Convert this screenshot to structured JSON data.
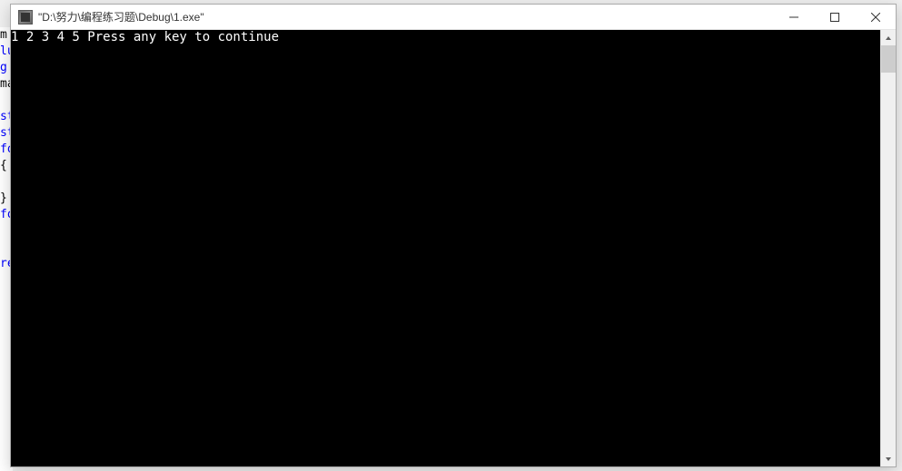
{
  "window": {
    "title": "\"D:\\努力\\编程练习题\\Debug\\1.exe\""
  },
  "console": {
    "output": "1 2 3 4 5 Press any key to continue"
  },
  "bgcode": {
    "l1": "m",
    "l2": "lu",
    "l3": "g",
    "l4": "ma",
    "l5": "st",
    "l6": "st",
    "l7": "fo",
    "l8": "{",
    "l9": " ",
    "l10": "}",
    "l11": "fo",
    "l12": " ",
    "l13": " ",
    "l14": "re"
  }
}
